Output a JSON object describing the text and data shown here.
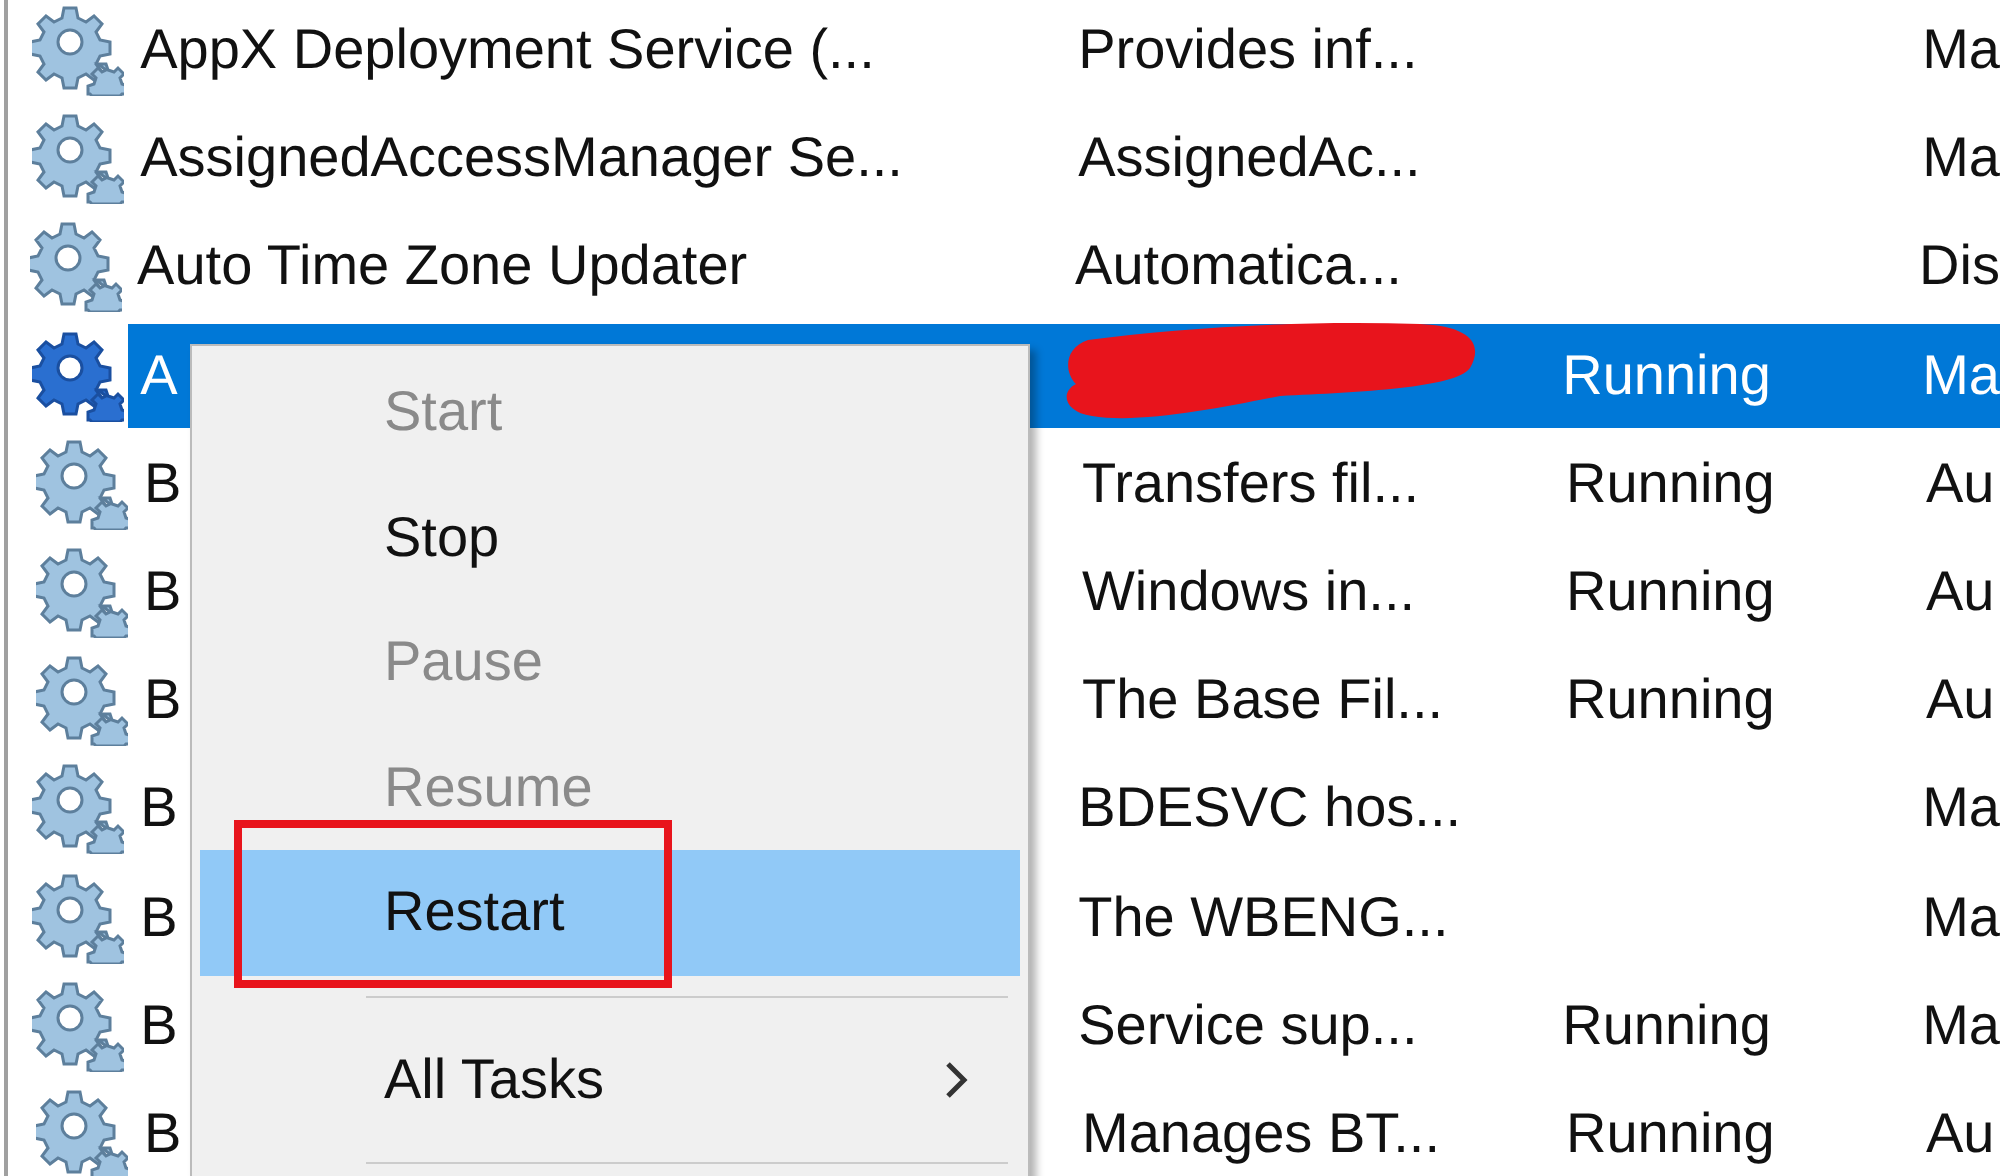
{
  "table": {
    "rows": [
      {
        "name": "AppX Deployment Service (...",
        "description": "Provides inf...",
        "startup": "Ma",
        "selected": false,
        "redacted": false
      },
      {
        "name": "AssignedAccessManager Se...",
        "description": "AssignedAc...",
        "startup": "Ma",
        "selected": false,
        "redacted": false
      },
      {
        "name": "Auto Time Zone Updater",
        "description": "Automatica...",
        "startup": "Dis",
        "selected": false,
        "redacted": false
      },
      {
        "name": "A",
        "status": "Running",
        "startup": "Ma",
        "selected": true,
        "redacted": true
      },
      {
        "name": "B",
        "description": "Transfers fil...",
        "status": "Running",
        "startup": "Au",
        "selected": false,
        "redacted": false
      },
      {
        "name": "B",
        "description": "Windows in...",
        "status": "Running",
        "startup": "Au",
        "selected": false,
        "redacted": false
      },
      {
        "name": "B",
        "description": "The Base Fil...",
        "status": "Running",
        "startup": "Au",
        "selected": false,
        "redacted": false
      },
      {
        "name": "B",
        "description": "BDESVC hos...",
        "startup": "Ma",
        "selected": false,
        "redacted": false
      },
      {
        "name": "B",
        "description": "The WBENG...",
        "startup": "Ma",
        "selected": false,
        "redacted": false
      },
      {
        "name": "B",
        "description": "Service sup...",
        "status": "Running",
        "startup": "Ma",
        "selected": false,
        "redacted": false
      },
      {
        "name": "B",
        "description": "Manages BT...",
        "status": "Running",
        "startup": "Au",
        "selected": false,
        "redacted": false
      }
    ]
  },
  "context_menu": {
    "items": [
      {
        "kind": "item",
        "label": "Start",
        "disabled": true,
        "selected": false,
        "outlined": false
      },
      {
        "kind": "item",
        "label": "Stop",
        "disabled": false,
        "selected": false,
        "outlined": false
      },
      {
        "kind": "item",
        "label": "Pause",
        "disabled": true,
        "selected": false,
        "outlined": false
      },
      {
        "kind": "item",
        "label": "Resume",
        "disabled": true,
        "selected": false,
        "outlined": false
      },
      {
        "kind": "item",
        "label": "Restart",
        "disabled": false,
        "selected": true,
        "outlined": true
      },
      {
        "kind": "separator"
      },
      {
        "kind": "submenu",
        "label": "All Tasks",
        "disabled": false,
        "selected": false,
        "outlined": false
      },
      {
        "kind": "separator"
      }
    ]
  }
}
